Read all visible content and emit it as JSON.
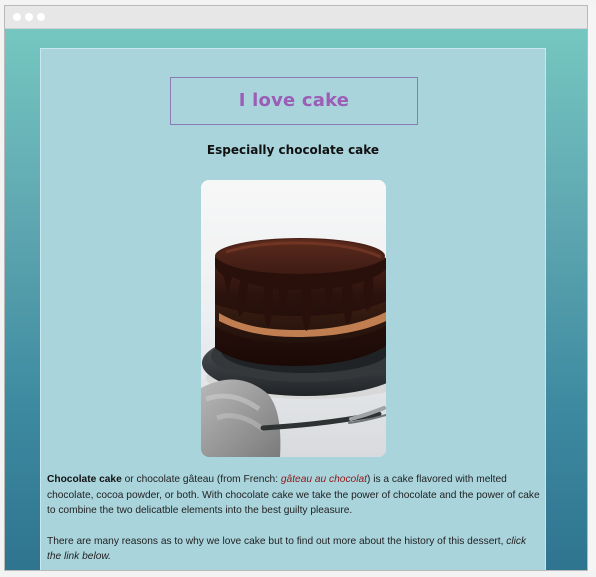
{
  "window": {
    "controls": [
      "window-dot",
      "window-dot",
      "window-dot"
    ]
  },
  "hero": {
    "title": "I love cake",
    "subtitle": "Especially chocolate cake"
  },
  "image": {
    "name": "chocolate-cake-image"
  },
  "article": {
    "paragraph1": {
      "term": "Chocolate cake",
      "before_link": " or chocolate gâteau (from French: ",
      "link": "gâteau au chocolat",
      "after_link": ") is a cake flavored with melted chocolate, cocoa powder, or both. With chocolate cake we take the power of chocolate and the power of cake to combine the two delicatble elements into the best guilty pleasure."
    },
    "paragraph2": {
      "text": "There are many reasons as to why we love cake but to find out more about the history of this dessert, ",
      "emphasis": "click the link below."
    }
  },
  "colors": {
    "title_purple": "#9b5db5",
    "card_blue": "#a9d4dc",
    "link_red": "#8d1818"
  }
}
